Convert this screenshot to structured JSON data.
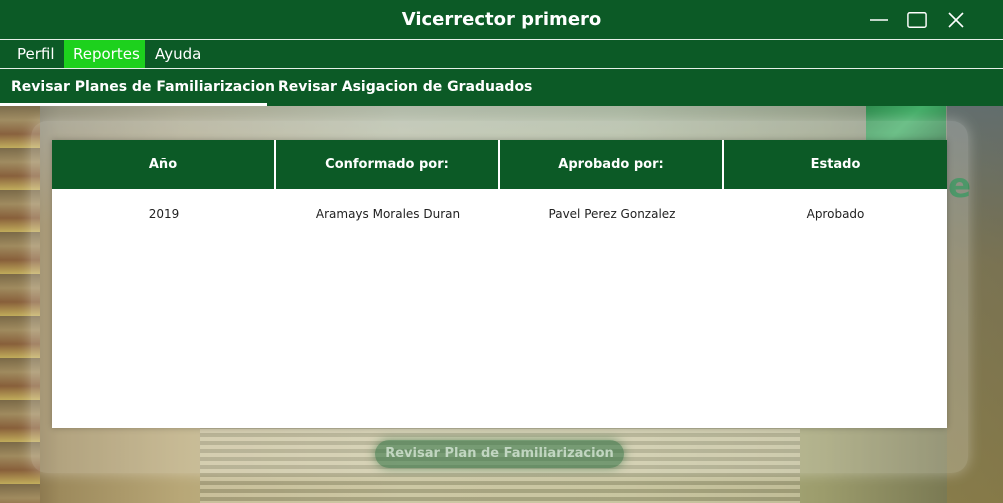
{
  "window": {
    "title": "Vicerrector primero",
    "controls": [
      "minimize-icon",
      "maximize-icon",
      "close-icon"
    ]
  },
  "menu": {
    "items": [
      {
        "label": "Perfil"
      },
      {
        "label": "Reportes",
        "active": true
      },
      {
        "label": "Ayuda"
      }
    ],
    "active_color": "#1dd11d"
  },
  "tabs": [
    {
      "label": "Revisar Planes de Familiarizacion",
      "selected": true
    },
    {
      "label": "Revisar Asigacion de Graduados",
      "selected": false
    }
  ],
  "table": {
    "columns": [
      "Año",
      "Conformado por:",
      "Aprobado por:",
      "Estado"
    ],
    "rows": [
      [
        "2019",
        "Aramays Morales Duran",
        "Pavel Perez Gonzalez",
        "Aprobado"
      ]
    ]
  },
  "actions": {
    "review_button": "Revisar Plan de Familiarizacion",
    "review_button_enabled": false
  },
  "theme": {
    "primary": "#0c5a26",
    "accent": "#1dd11d",
    "text_on_primary": "#ffffff"
  }
}
